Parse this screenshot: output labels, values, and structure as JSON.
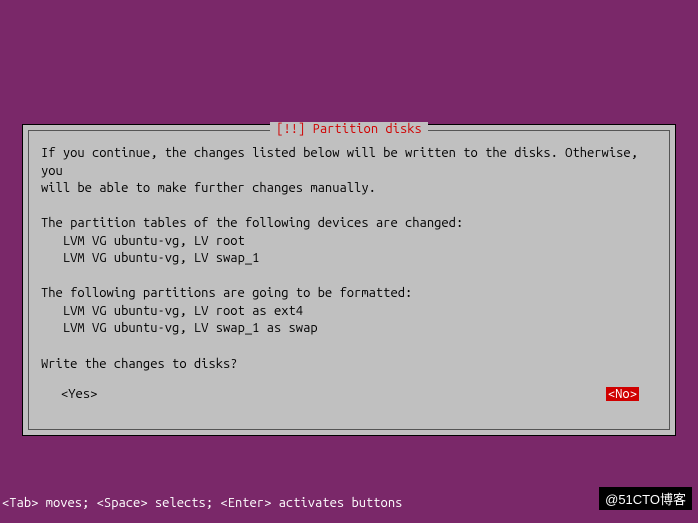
{
  "dialog": {
    "title": "[!!] Partition disks",
    "body_lines": [
      "If you continue, the changes listed below will be written to the disks. Otherwise, you",
      "will be able to make further changes manually.",
      "",
      "The partition tables of the following devices are changed:",
      "   LVM VG ubuntu-vg, LV root",
      "   LVM VG ubuntu-vg, LV swap_1",
      "",
      "The following partitions are going to be formatted:",
      "   LVM VG ubuntu-vg, LV root as ext4",
      "   LVM VG ubuntu-vg, LV swap_1 as swap",
      "",
      "Write the changes to disks?"
    ],
    "yes_label": "<Yes>",
    "no_label": "<No>",
    "selected": "no"
  },
  "help_bar": "<Tab> moves; <Space> selects; <Enter> activates buttons",
  "watermark": "@51CTO博客"
}
